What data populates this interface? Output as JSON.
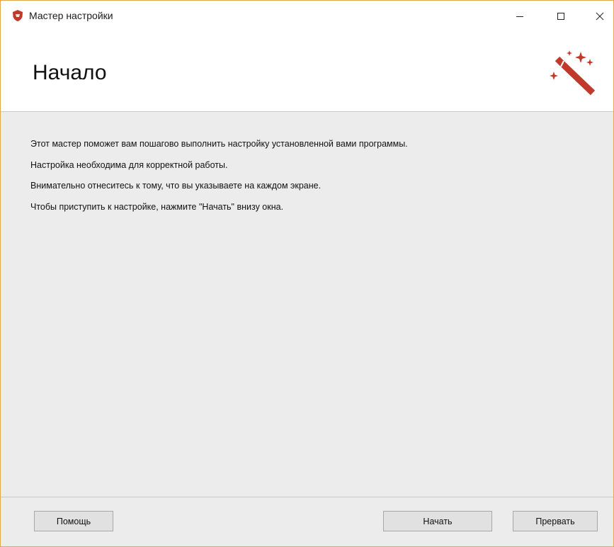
{
  "window": {
    "title": "Мастер настройки",
    "accent_color": "#c0392b",
    "icons": {
      "app": "app-logo-icon",
      "minimize": "minimize-icon",
      "maximize": "maximize-icon",
      "close": "close-icon",
      "header": "magic-wand-icon"
    }
  },
  "header": {
    "title": "Начало"
  },
  "content": {
    "lines": [
      "Этот мастер поможет вам пошагово выполнить настройку установленной вами программы.",
      "Настройка необходима для корректной работы.",
      "Внимательно отнеситесь к тому, что вы указываете на каждом экране.",
      "Чтобы приступить к настройке, нажмите \"Начать\" внизу окна."
    ]
  },
  "footer": {
    "help_label": "Помощь",
    "start_label": "Начать",
    "abort_label": "Прервать"
  }
}
